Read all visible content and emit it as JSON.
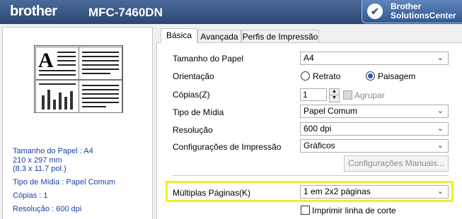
{
  "header": {
    "brand": "brother",
    "model": "MFC-7460DN",
    "solutions_center": [
      "Brother",
      "SolutionsCenter"
    ]
  },
  "tabs": [
    "Básica",
    "Avançada",
    "Perfis de Impressão"
  ],
  "preview_info": {
    "paper_size": "Tamanho do Papel : A4",
    "dimensions_mm": "210 x 297 mm",
    "dimensions_in": "(8.3 x 11.7 pol.)",
    "media_type": "Tipo de Mídia : Papel Comum",
    "copies": "Cópias : 1",
    "resolution": "Resolução : 600 dpi"
  },
  "form": {
    "paper_size": {
      "label": "Tamanho do Papel",
      "value": "A4"
    },
    "orientation": {
      "label": "Orientação",
      "options": [
        "Retrato",
        "Paisagem"
      ],
      "selected": "Paisagem"
    },
    "copies": {
      "label": "Cópias(Z)",
      "value": "1",
      "collate_label": "Agrupar"
    },
    "media_type": {
      "label": "Tipo de Mídia",
      "value": "Papel Comum"
    },
    "resolution": {
      "label": "Resolução",
      "value": "600 dpi"
    },
    "print_settings": {
      "label": "Configurações de Impressão",
      "value": "Gráficos"
    },
    "manual_settings_button": "Configurações Manuais...",
    "multiple_pages": {
      "label": "Múltiplas Páginas(K)",
      "value": "1 em 2x2 páginas"
    },
    "cut_line": {
      "label": "Imprimir linha de corte"
    }
  },
  "colors": {
    "header": "#2b4770",
    "info_text": "#1a3fa8",
    "highlight": "#f2ee2a"
  }
}
